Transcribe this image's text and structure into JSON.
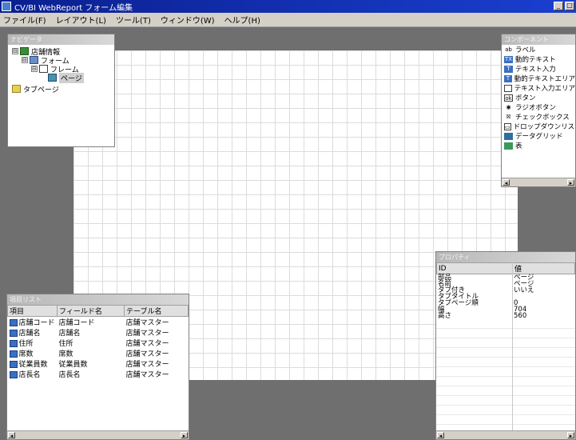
{
  "window": {
    "title": "CV/BI WebReport フォーム編集",
    "minimize": "_",
    "restore": "□"
  },
  "menu": [
    "ファイル(F)",
    "レイアウト(L)",
    "ツール(T)",
    "ウィンドウ(W)",
    "ヘルプ(H)"
  ],
  "navigator": {
    "title": "ナビゲータ",
    "nodes": [
      {
        "toggle": "⊟",
        "icon": "tree",
        "label": "店舗情報",
        "level": 0
      },
      {
        "toggle": "⊟",
        "icon": "form",
        "label": "フォーム",
        "level": 1
      },
      {
        "toggle": "⊟",
        "icon": "frame",
        "label": "フレーム",
        "level": 2
      },
      {
        "toggle": "",
        "icon": "page",
        "label": "ページ",
        "level": 3,
        "selected": true
      },
      {
        "toggle": "",
        "icon": "folder",
        "label": "タブページ",
        "level": 0
      }
    ]
  },
  "palette": {
    "title": "コンポーネント",
    "items": [
      {
        "icon": "ab",
        "label": "ラベル"
      },
      {
        "icon": "TX",
        "label": "動的テキスト"
      },
      {
        "icon": "T",
        "label": "テキスト入力"
      },
      {
        "icon": "T",
        "label": "動的テキストエリア"
      },
      {
        "icon": "",
        "label": "テキスト入力エリア"
      },
      {
        "icon": "ok",
        "label": "ボタン"
      },
      {
        "icon": "◉",
        "label": "ラジオボタン"
      },
      {
        "icon": "☒",
        "label": "チェックボックス"
      },
      {
        "icon": "▭",
        "label": "ドロップダウンリスト"
      },
      {
        "icon": "",
        "label": "データグリッド"
      },
      {
        "icon": "",
        "label": "表"
      }
    ]
  },
  "fieldlist": {
    "title": "項目リスト",
    "columns": [
      "項目",
      "フィールド名",
      "テーブル名"
    ],
    "rows": [
      [
        "店舗コード",
        "店舗コード",
        "店舗マスター"
      ],
      [
        "店舗名",
        "店舗名",
        "店舗マスター"
      ],
      [
        "住所",
        "住所",
        "店舗マスター"
      ],
      [
        "席数",
        "席数",
        "店舗マスター"
      ],
      [
        "従業員数",
        "従業員数",
        "店舗マスター"
      ],
      [
        "店長名",
        "店長名",
        "店舗マスター"
      ]
    ]
  },
  "properties": {
    "title": "プロパティ",
    "columns": [
      "ID",
      "値"
    ],
    "rows": [
      [
        "部品",
        "ページ"
      ],
      [
        "名前",
        "ページ"
      ],
      [
        "タブ付き",
        "いいえ"
      ],
      [
        "タブタイトル",
        ""
      ],
      [
        "タブページ順",
        "0"
      ],
      [
        "幅",
        "704"
      ],
      [
        "高さ",
        "560"
      ]
    ]
  },
  "scroll": {
    "left": "◂",
    "right": "▸"
  }
}
